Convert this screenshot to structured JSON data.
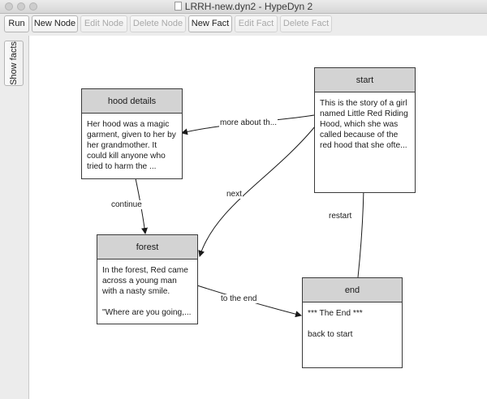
{
  "window": {
    "title": "LRRH-new.dyn2 - HypeDyn 2"
  },
  "toolbar": {
    "run": "Run",
    "new_node": "New Node",
    "edit_node": "Edit Node",
    "delete_node": "Delete Node",
    "new_fact": "New Fact",
    "edit_fact": "Edit Fact",
    "delete_fact": "Delete Fact"
  },
  "sidebar": {
    "show_facts": "Show facts"
  },
  "nodes": {
    "hood_details": {
      "title": "hood details",
      "text": "Her hood was a magic\ngarment, given to her by\nher grandmother. It\ncould kill anyone who\ntried to harm the ..."
    },
    "start": {
      "title": "start",
      "text": "This is the story of a girl\nnamed Little Red Riding\nHood, which she was\ncalled because of the\nred hood that she ofte..."
    },
    "forest": {
      "title": "forest",
      "text": "In the forest, Red came\nacross a young man\nwith a nasty smile.\n\n\"Where are you going,..."
    },
    "end": {
      "title": "end",
      "text": "*** The End ***\n\nback to start"
    }
  },
  "edges": {
    "more_about": "more about th...",
    "continue": "continue",
    "next": "next",
    "restart": "restart",
    "to_the_end": "to the end"
  }
}
